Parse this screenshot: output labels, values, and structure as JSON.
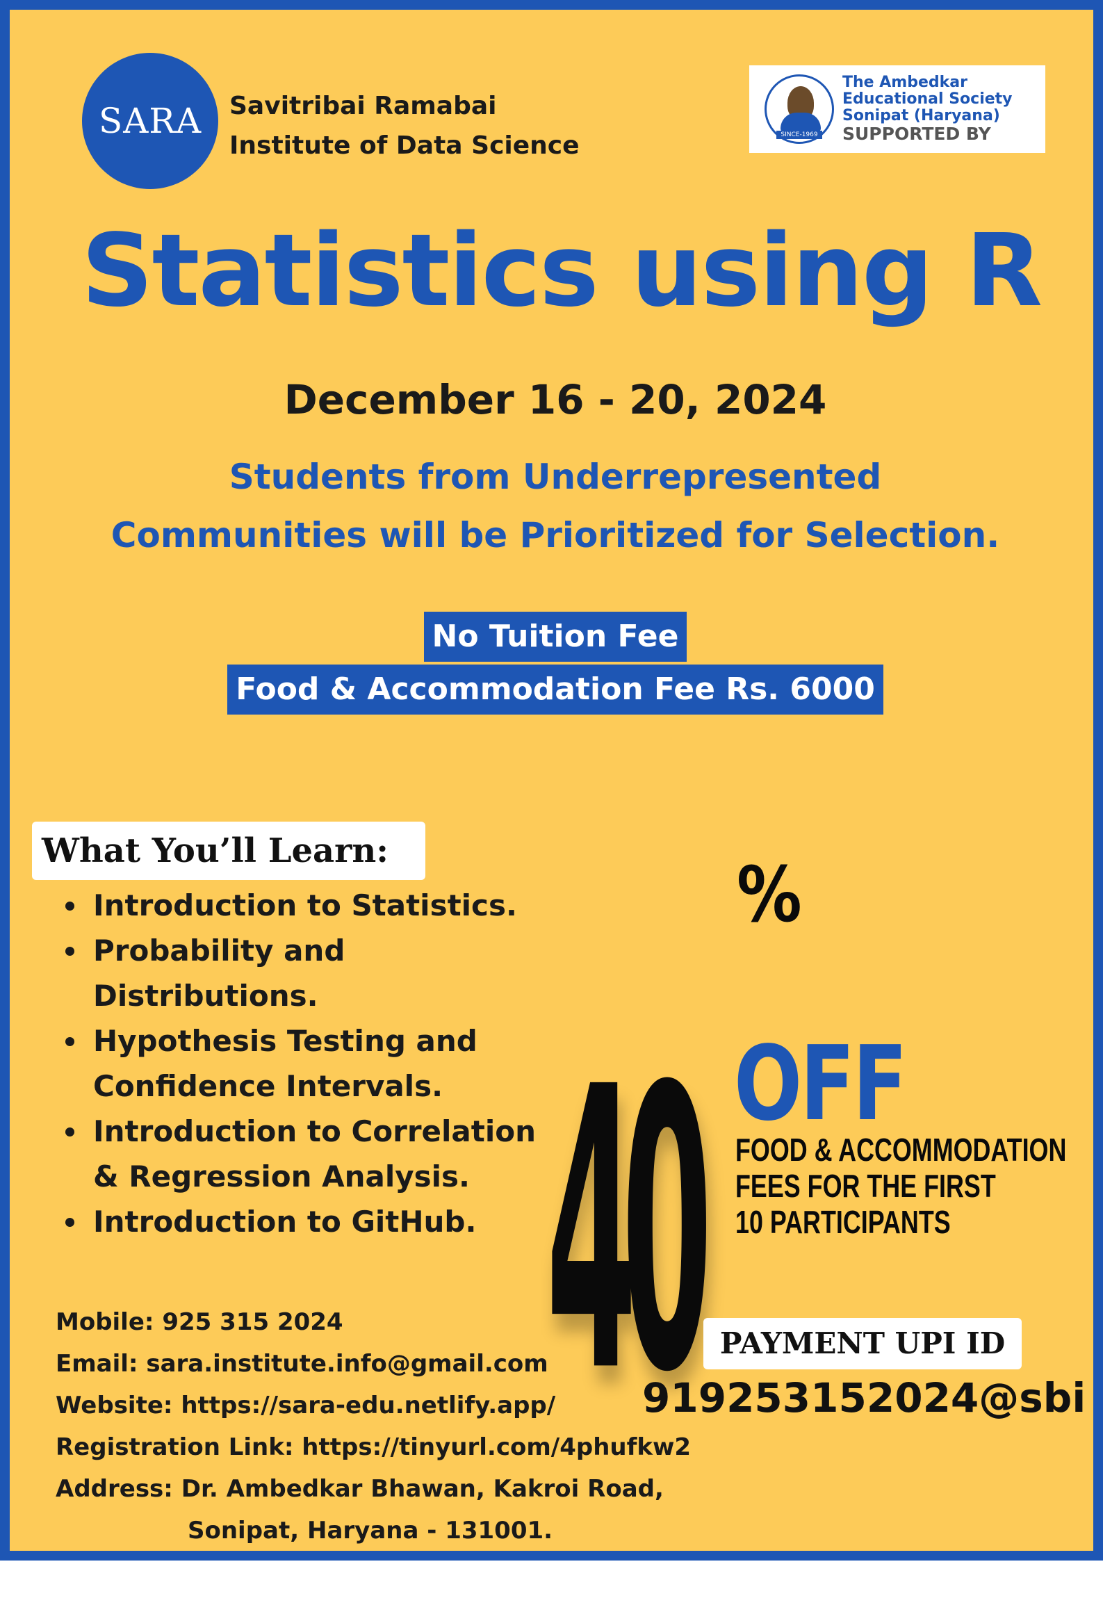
{
  "header": {
    "logo_text": "SARA",
    "institute_line1": "Savitribai Ramabai",
    "institute_line2": "Institute of Data Science",
    "supporter": {
      "name_line1": "The Ambedkar",
      "name_line2": "Educational Society",
      "name_line3": "Sonipat (Haryana)",
      "supported_by": "SUPPORTED BY",
      "seal_text": "SINCE-1969"
    }
  },
  "title": "Statistics using R",
  "date": "December 16 - 20, 2024",
  "priority": {
    "line1": "Students from Underrepresented",
    "line2": "Communities will be Prioritized for Selection."
  },
  "fees": {
    "line1": "No Tuition Fee",
    "line2": "Food & Accommodation Fee Rs. 6000"
  },
  "learn": {
    "label": "What You’ll Learn:",
    "items": [
      {
        "line1": "Introduction to Statistics.",
        "line2": ""
      },
      {
        "line1": "Probability and",
        "line2": "Distributions."
      },
      {
        "line1": "Hypothesis Testing and",
        "line2": "Confidence Intervals."
      },
      {
        "line1": "Introduction to Correlation",
        "line2": "& Regression Analysis."
      },
      {
        "line1": "Introduction to GitHub.",
        "line2": ""
      }
    ]
  },
  "discount": {
    "number": "40",
    "percent": "%",
    "off": "OFF",
    "detail_line1": "FOOD & ACCOMMODATION",
    "detail_line2": "FEES FOR THE FIRST",
    "detail_line3": "10 PARTICIPANTS"
  },
  "contact": {
    "mobile": "Mobile: 925 315 2024",
    "email": "Email: sara.institute.info@gmail.com",
    "website": "Website: https://sara-edu.netlify.app/",
    "registration": "Registration Link: https://tinyurl.com/4phufkw2",
    "address_line1": "Address: Dr. Ambedkar Bhawan, Kakroi Road,",
    "address_line2": "Sonipat, Haryana - 131001."
  },
  "payment": {
    "label": "PAYMENT UPI ID",
    "upi_id": "919253152024@sbi"
  },
  "colors": {
    "background": "#FDCB58",
    "brand_blue": "#1E56B4",
    "text_dark": "#1a1a1a"
  }
}
